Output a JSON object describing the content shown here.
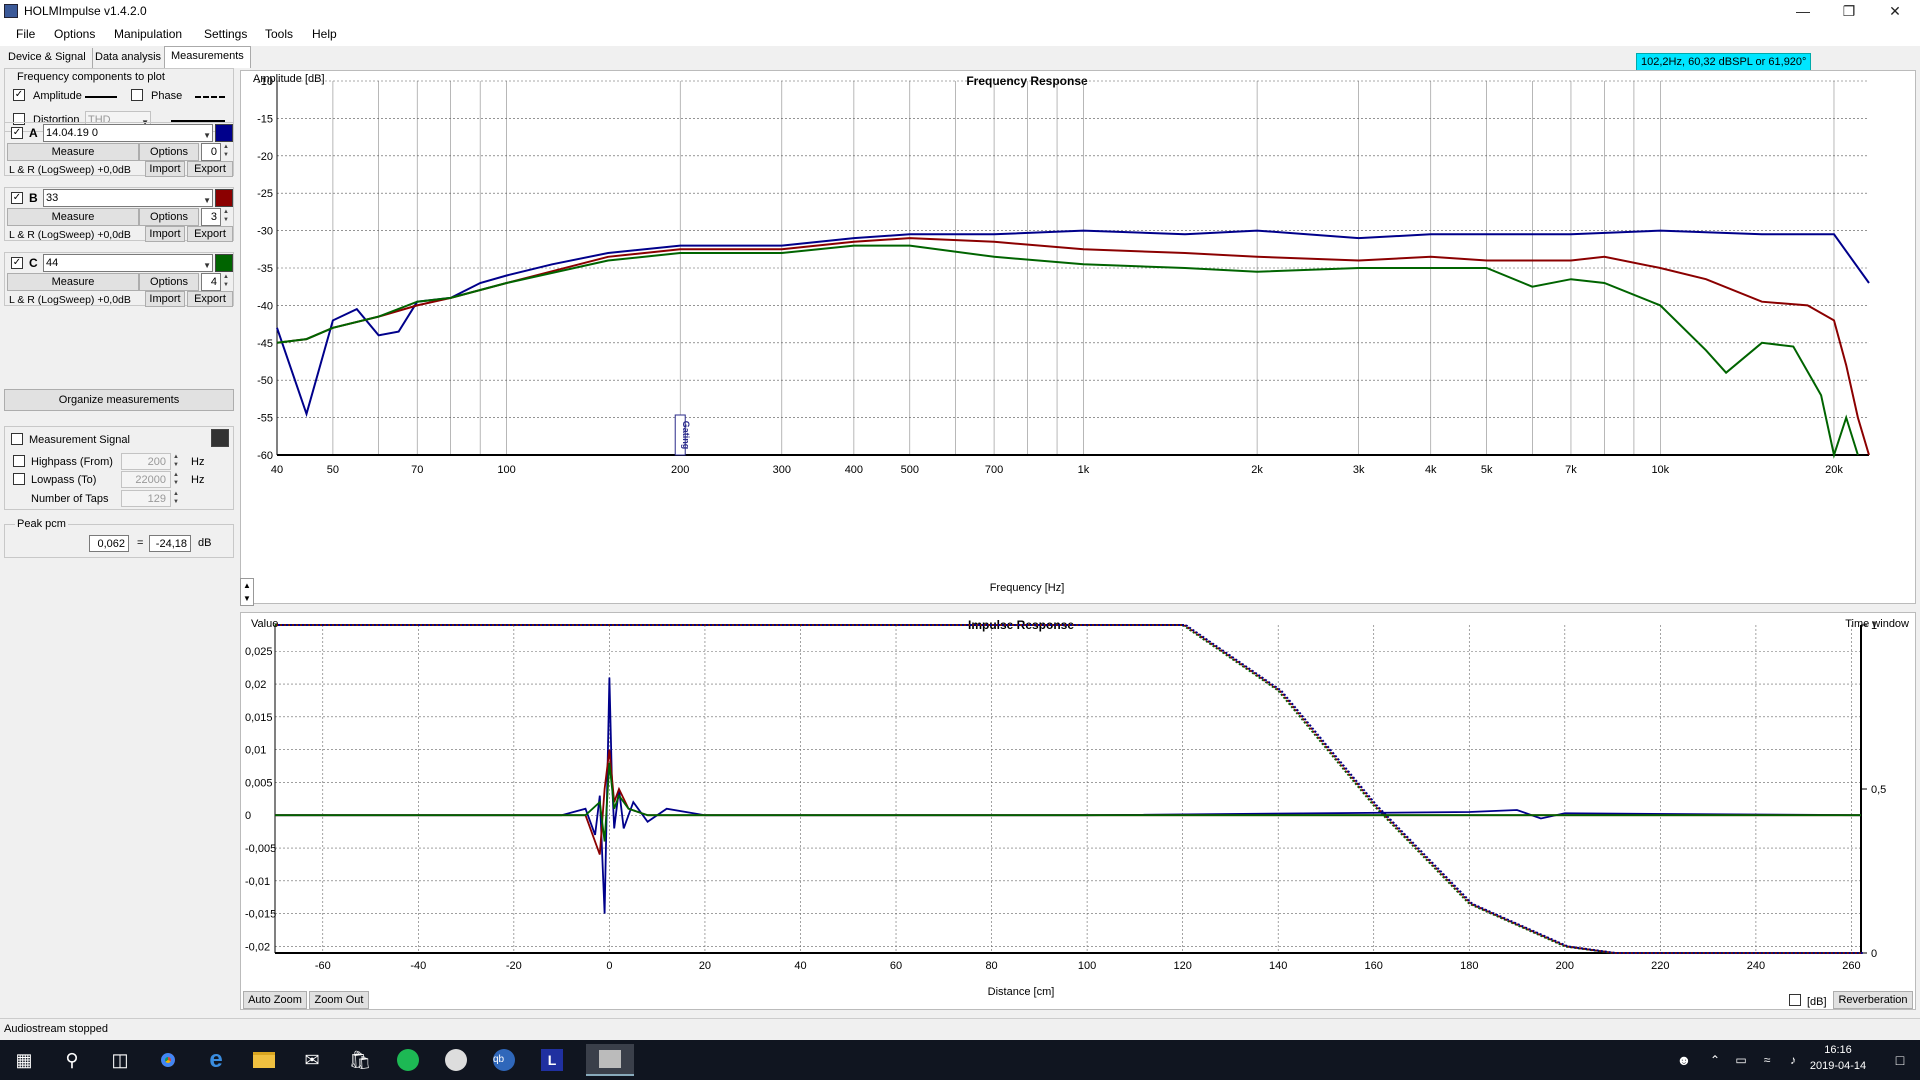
{
  "window": {
    "title": "HOLMImpulse  v1.4.2.0"
  },
  "menu": [
    "File",
    "Options",
    "Manipulation",
    "Settings",
    "Tools",
    "Help"
  ],
  "tabs": [
    "Device & Signal",
    "Data analysis",
    "Measurements"
  ],
  "tooltip": "102,2Hz, 60,32 dBSPL or 61,920°",
  "freq_components": {
    "title": "Frequency components to plot",
    "amplitude_label": "Amplitude",
    "phase_label": "Phase",
    "distortion_label": "Distortion",
    "distortion_value": "THD"
  },
  "measurements": [
    {
      "letter": "A",
      "name": "14.04.19  0",
      "color": "#00008b",
      "offset": "0",
      "desc": "L & R (LogSweep) +0,0dB"
    },
    {
      "letter": "B",
      "name": "33",
      "color": "#8b0000",
      "offset": "3",
      "desc": "L & R (LogSweep) +0,0dB"
    },
    {
      "letter": "C",
      "name": "44",
      "color": "#006400",
      "offset": "4",
      "desc": "L & R (LogSweep) +0,0dB"
    }
  ],
  "buttons": {
    "measure": "Measure",
    "options": "Options",
    "import": "Import",
    "export": "Export",
    "organize": "Organize measurements",
    "auto_zoom": "Auto Zoom",
    "zoom_out": "Zoom Out",
    "reverberation": "Reverberation"
  },
  "signal": {
    "measurement_signal": "Measurement Signal",
    "highpass_label": "Highpass (From)",
    "highpass_value": "200",
    "lowpass_label": "Lowpass (To)",
    "lowpass_value": "22000",
    "taps_label": "Number of Taps",
    "taps_value": "129",
    "hz": "Hz"
  },
  "peak": {
    "label": "Peak pcm",
    "value": "0,062",
    "eq": "=",
    "db_value": "-24,18",
    "db_unit": "dB"
  },
  "db_label": "[dB]",
  "status": "Audiostream stopped",
  "clock": {
    "time": "16:16",
    "date": "2019-04-14"
  },
  "gating_label": "Gating",
  "chart_data": [
    {
      "type": "line",
      "title": "Frequency Response",
      "ylabel": "Amplitude [dB]",
      "xlabel": "Frequency [Hz]",
      "xscale": "log",
      "xlim": [
        40,
        23000
      ],
      "ylim": [
        -60,
        -10
      ],
      "xticks": [
        40,
        50,
        70,
        100,
        200,
        300,
        400,
        500,
        700,
        1000,
        2000,
        3000,
        4000,
        5000,
        7000,
        10000,
        20000
      ],
      "xticklabels": [
        "40",
        "50",
        "70",
        "100",
        "200",
        "300",
        "400",
        "500",
        "700",
        "1k",
        "2k",
        "3k",
        "4k",
        "5k",
        "7k",
        "10k",
        "20k"
      ],
      "yticks": [
        -10,
        -15,
        -20,
        -25,
        -30,
        -35,
        -40,
        -45,
        -50,
        -55,
        -60
      ],
      "grid": true,
      "series": [
        {
          "color": "#00008b",
          "x": [
            40,
            45,
            50,
            55,
            60,
            65,
            70,
            80,
            90,
            100,
            120,
            150,
            200,
            300,
            400,
            500,
            700,
            1000,
            1500,
            2000,
            3000,
            4000,
            5000,
            7000,
            10000,
            15000,
            20000,
            23000
          ],
          "y": [
            -43,
            -54.5,
            -42,
            -40.5,
            -44,
            -43.5,
            -39.5,
            -39,
            -37,
            -36,
            -34.5,
            -33,
            -32,
            -32,
            -31,
            -30.5,
            -30.5,
            -30,
            -30.5,
            -30,
            -31,
            -30.5,
            -30.5,
            -30.5,
            -30,
            -30.5,
            -30.5,
            -37
          ]
        },
        {
          "color": "#8b0000",
          "x": [
            40,
            45,
            50,
            60,
            70,
            80,
            100,
            150,
            200,
            300,
            400,
            500,
            700,
            1000,
            1500,
            2000,
            3000,
            4000,
            5000,
            7000,
            8000,
            10000,
            12000,
            15000,
            18000,
            20000,
            21000,
            22000,
            23000
          ],
          "y": [
            -45,
            -44.5,
            -43,
            -41.5,
            -40,
            -39,
            -37,
            -33.5,
            -32.5,
            -32.5,
            -31.5,
            -31,
            -31.5,
            -32.5,
            -33,
            -33.5,
            -34,
            -33.5,
            -34,
            -34,
            -33.5,
            -35,
            -36.5,
            -39.5,
            -40,
            -42,
            -48,
            -55,
            -60
          ]
        },
        {
          "color": "#006400",
          "x": [
            40,
            45,
            50,
            60,
            70,
            80,
            100,
            150,
            200,
            300,
            400,
            500,
            700,
            1000,
            1500,
            2000,
            3000,
            4000,
            5000,
            6000,
            7000,
            8000,
            10000,
            12000,
            13000,
            15000,
            17000,
            19000,
            20000,
            21000,
            22000
          ],
          "y": [
            -45,
            -44.5,
            -43,
            -41.5,
            -39.5,
            -39,
            -37,
            -34,
            -33,
            -33,
            -32,
            -32,
            -33.5,
            -34.5,
            -35,
            -35.5,
            -35,
            -35,
            -35,
            -37.5,
            -36.5,
            -37,
            -40,
            -46,
            -49,
            -45,
            -45.5,
            -52,
            -60,
            -55,
            -60
          ]
        }
      ],
      "annotation": "102,2Hz, 60,32 dBSPL or 61,920°"
    },
    {
      "type": "line",
      "title": "Impulse Response",
      "ylabel": "Value",
      "xlabel": "Distance [cm]",
      "y2label": "Time window",
      "xlim": [
        -70,
        262
      ],
      "ylim": [
        -0.021,
        0.029
      ],
      "xticks": [
        -60,
        -40,
        -20,
        0,
        20,
        40,
        60,
        80,
        100,
        120,
        140,
        160,
        180,
        200,
        220,
        240,
        260
      ],
      "yticks": [
        0.025,
        0.02,
        0.015,
        0.01,
        0.005,
        0,
        -0.005,
        -0.01,
        -0.015,
        -0.02
      ],
      "yticklabels": [
        "0,025",
        "0,02",
        "0,015",
        "0,01",
        "0,005",
        "0",
        "-0,005",
        "-0,01",
        "-0,015",
        "-0,02"
      ],
      "y2ticks": [
        1,
        0.5,
        0
      ],
      "y2ticklabels": [
        "1",
        "0,5",
        "0"
      ],
      "grid": true,
      "window": {
        "x": [
          -70,
          0,
          120,
          140,
          160,
          180,
          200,
          210,
          262
        ],
        "y": [
          1,
          1,
          1,
          0.8,
          0.45,
          0.15,
          0.02,
          0,
          0
        ]
      },
      "series": [
        {
          "color": "#00008b",
          "x": [
            -70,
            -10,
            -5,
            -3,
            -2,
            -1,
            0,
            0.5,
            1,
            2,
            3,
            5,
            8,
            12,
            20,
            40,
            100,
            180,
            190,
            195,
            200,
            262
          ],
          "y": [
            0,
            0,
            0.001,
            -0.003,
            0.003,
            -0.015,
            0.021,
            0.006,
            -0.002,
            0.004,
            -0.002,
            0.002,
            -0.001,
            0.001,
            0,
            0,
            0,
            0.0005,
            0.0008,
            -0.0005,
            0.0003,
            0
          ]
        },
        {
          "color": "#8b0000",
          "x": [
            -70,
            -5,
            -2,
            -1,
            0,
            1,
            2,
            4,
            8,
            20,
            262
          ],
          "y": [
            0,
            0,
            -0.006,
            0.004,
            0.01,
            0.002,
            0.004,
            0.001,
            0,
            0,
            0
          ]
        },
        {
          "color": "#006400",
          "x": [
            -70,
            -5,
            -2,
            -1,
            0,
            1,
            2,
            4,
            8,
            20,
            262
          ],
          "y": [
            0,
            0,
            0.002,
            -0.004,
            0.008,
            0.001,
            0.003,
            0.001,
            0,
            0,
            0
          ]
        }
      ]
    }
  ]
}
